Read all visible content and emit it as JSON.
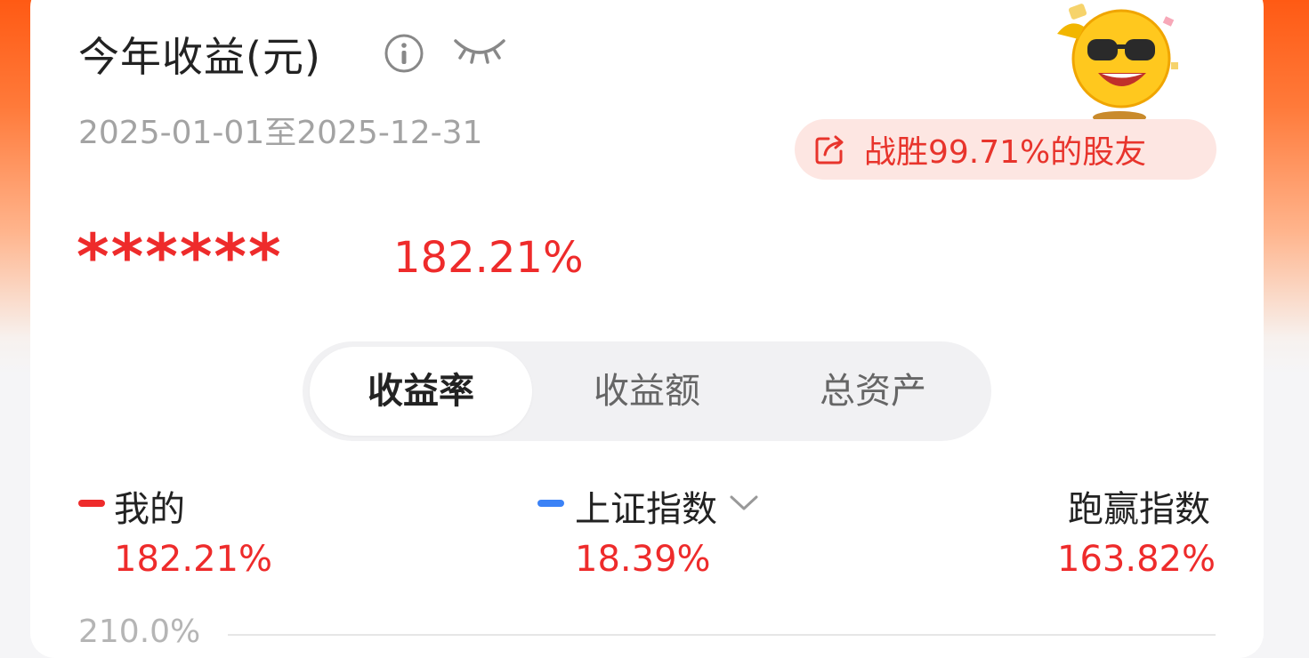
{
  "header": {
    "title": "今年收益(元)",
    "date_range": "2025-01-01至2025-12-31",
    "beat_text": "战胜99.71%的股友"
  },
  "summary": {
    "masked_amount": "******",
    "return_pct": "182.21%"
  },
  "tabs": [
    {
      "label": "收益率",
      "active": true
    },
    {
      "label": "收益额",
      "active": false
    },
    {
      "label": "总资产",
      "active": false
    }
  ],
  "legend": {
    "mine": {
      "label": "我的",
      "value": "182.21%",
      "color": "#ee2b2b"
    },
    "index": {
      "label": "上证指数",
      "value": "18.39%",
      "color": "#3b82f6"
    },
    "outperform": {
      "label": "跑赢指数",
      "value": "163.82%"
    }
  },
  "chart": {
    "y_tick_top": "210.0%"
  },
  "icons": {
    "info": "info-icon",
    "hidden": "eye-closed-icon",
    "share": "share-icon",
    "dropdown": "chevron-down-icon",
    "mascot": "sunglasses-emoji-mascot"
  },
  "colors": {
    "accent_red": "#ee2b2b",
    "badge_bg": "#fde6e2",
    "header_orange": "#ff5a14"
  }
}
